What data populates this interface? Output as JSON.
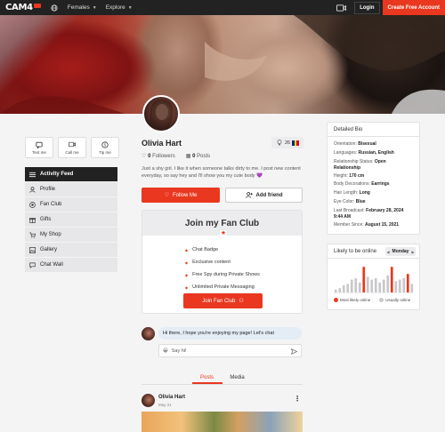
{
  "topbar": {
    "logo_text": "CAM4",
    "nav_females": "Females",
    "nav_explore": "Explore",
    "login": "Login",
    "create_account": "Create Free Account"
  },
  "sidebar": {
    "actions": [
      {
        "label": "Text me",
        "icon": "message-icon"
      },
      {
        "label": "Call me",
        "icon": "camera-icon"
      },
      {
        "label": "Tip me",
        "icon": "coin-icon"
      }
    ],
    "menu": [
      {
        "label": "Activity Feed",
        "icon": "list-icon",
        "active": true
      },
      {
        "label": "Profile",
        "icon": "user-icon"
      },
      {
        "label": "Fan Club",
        "icon": "fanclub-icon"
      },
      {
        "label": "Gifts",
        "icon": "gift-icon"
      },
      {
        "label": "My Shop",
        "icon": "shop-icon"
      },
      {
        "label": "Gallery",
        "icon": "gallery-icon"
      },
      {
        "label": "Chat Wall",
        "icon": "chat-icon"
      }
    ]
  },
  "profile": {
    "name": "Olivia Hart",
    "level": "26",
    "followers_count": "0",
    "followers_label": "Followers",
    "posts_count": "0",
    "posts_label": "Posts",
    "bio": "Just a shy girl. I like it when someone talks dirty to me. I post new content everyday, so say hey and I'll show you my cute body 💜",
    "follow_label": "Follow Me",
    "add_friend_label": "Add friend"
  },
  "fanclub": {
    "title": "Join my Fan Club",
    "perks": [
      "Chat Badge",
      "Exclusive content",
      "Free Spy during Private Shows",
      "Unlimited Private Messaging"
    ],
    "button": "Join Fan Club"
  },
  "chat": {
    "message": "Hi there, I hope you're enjoying my page! Let's chat",
    "input_placeholder": "Say hi!",
    "emoji": "😀"
  },
  "tabs": [
    "Posts",
    "Media"
  ],
  "post": {
    "author": "Olivia Hart",
    "date": "May 21"
  },
  "detailed_bio": {
    "title": "Detailed Bio",
    "rows": [
      {
        "label": "Orientation:",
        "value": "Bisexual"
      },
      {
        "label": "Languages:",
        "value": "Russian, English"
      },
      {
        "label": "Relationship Status:",
        "value": "Open Relationship"
      },
      {
        "label": "Height:",
        "value": "170 cm"
      },
      {
        "label": "Body Decorations:",
        "value": "Earrings"
      },
      {
        "label": "Hair Length:",
        "value": "Long"
      },
      {
        "label": "Eye Color:",
        "value": "Blue"
      },
      {
        "label": "Last Broadcast:",
        "value": "February 28, 2024 9:44 AM"
      },
      {
        "label": "Member Since:",
        "value": "August 15, 2021"
      }
    ]
  },
  "online": {
    "title": "Likely to be online",
    "day": "Monday",
    "legend_most": "Most likely online",
    "legend_usual": "Usually online",
    "colors": {
      "most": "#e9381f",
      "usual": "#c8c8cc"
    },
    "levels": [
      0.1,
      0.15,
      0.25,
      0.3,
      0.45,
      0.5,
      0.35,
      0.9,
      0.55,
      0.45,
      0.5,
      0.35,
      0.45,
      0.6,
      0.9,
      0.4,
      0.45,
      0.5,
      0.65,
      0.3
    ],
    "highlight": [
      7,
      14,
      18
    ]
  },
  "colors": {
    "accent": "#e9381f",
    "dark": "#222222"
  }
}
